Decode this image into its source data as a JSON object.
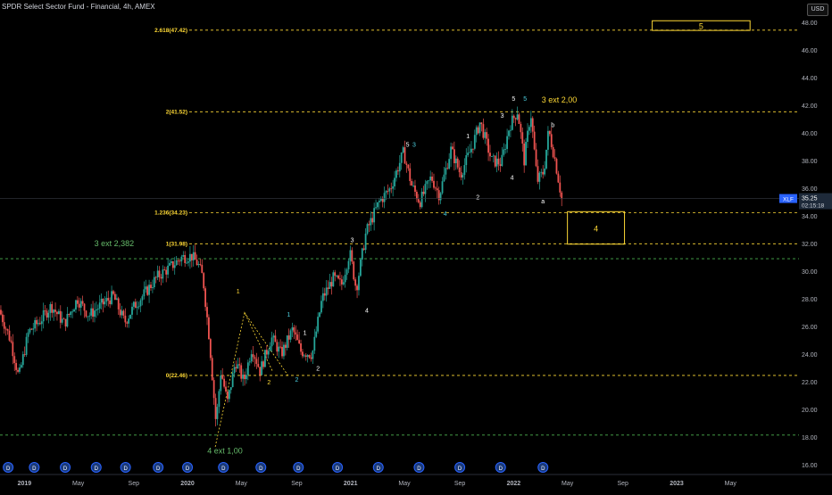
{
  "title": "SPDR Select Sector Fund - Financial, 4h, AMEX",
  "currency_button": "USD",
  "colors": {
    "up": "#26a69a",
    "down": "#ef5350",
    "fib": "#fdd835",
    "green_dash": "#4caf50",
    "axis_text": "#b2b5be",
    "ticker_bg": "#2962ff",
    "wave_white": "#ffffff",
    "wave_cyan": "#4dd0e1",
    "wave_yellow": "#fdd835",
    "wave_green": "#66bb6a"
  },
  "chart_data": {
    "type": "candlestick",
    "symbol": "XLF",
    "last_price_label": "35.25",
    "countdown_label": "02:15:18",
    "last_price_tag_text": "XLF",
    "ylim": [
      15.3,
      49.6
    ],
    "y_ticks": [
      "16.00",
      "18.00",
      "20.00",
      "22.00",
      "24.00",
      "26.00",
      "28.00",
      "30.00",
      "32.00",
      "34.00",
      "36.00",
      "38.00",
      "40.00",
      "42.00",
      "44.00",
      "46.00",
      "48.00"
    ],
    "y_tick_values": [
      16,
      18,
      20,
      22,
      24,
      26,
      28,
      30,
      32,
      34,
      36,
      38,
      40,
      42,
      44,
      46,
      48
    ],
    "x_ticks": [
      "2019",
      "May",
      "Sep",
      "2020",
      "May",
      "Sep",
      "2021",
      "May",
      "Sep",
      "2022",
      "May",
      "Sep",
      "2023",
      "May"
    ],
    "x_tick_dates": [
      2019.0,
      2019.33,
      2019.67,
      2020.0,
      2020.33,
      2020.67,
      2021.0,
      2021.33,
      2021.67,
      2022.0,
      2022.33,
      2022.67,
      2023.0,
      2023.33
    ],
    "xlim": [
      2018.85,
      2023.75
    ],
    "price_path": [
      [
        2018.85,
        27.2
      ],
      [
        2018.92,
        25.0
      ],
      [
        2018.97,
        22.3
      ],
      [
        2019.03,
        25.6
      ],
      [
        2019.1,
        26.4
      ],
      [
        2019.17,
        27.5
      ],
      [
        2019.25,
        26.2
      ],
      [
        2019.33,
        28.0
      ],
      [
        2019.4,
        26.8
      ],
      [
        2019.47,
        27.5
      ],
      [
        2019.55,
        28.2
      ],
      [
        2019.62,
        26.3
      ],
      [
        2019.68,
        27.5
      ],
      [
        2019.75,
        28.5
      ],
      [
        2019.82,
        29.6
      ],
      [
        2019.9,
        30.3
      ],
      [
        2019.97,
        31.0
      ],
      [
        2020.03,
        31.1
      ],
      [
        2020.07,
        30.5
      ],
      [
        2020.1,
        29.5
      ],
      [
        2020.14,
        25.0
      ],
      [
        2020.18,
        19.0
      ],
      [
        2020.21,
        22.8
      ],
      [
        2020.25,
        20.5
      ],
      [
        2020.3,
        23.5
      ],
      [
        2020.35,
        22.0
      ],
      [
        2020.4,
        24.5
      ],
      [
        2020.45,
        22.8
      ],
      [
        2020.52,
        25.2
      ],
      [
        2020.58,
        24.0
      ],
      [
        2020.65,
        25.8
      ],
      [
        2020.7,
        24.2
      ],
      [
        2020.77,
        24.0
      ],
      [
        2020.83,
        28.0
      ],
      [
        2020.9,
        29.5
      ],
      [
        2020.95,
        29.0
      ],
      [
        2021.0,
        31.4
      ],
      [
        2021.04,
        28.7
      ],
      [
        2021.1,
        32.8
      ],
      [
        2021.18,
        35.0
      ],
      [
        2021.25,
        36.0
      ],
      [
        2021.33,
        38.6
      ],
      [
        2021.38,
        36.2
      ],
      [
        2021.43,
        35.0
      ],
      [
        2021.5,
        36.8
      ],
      [
        2021.55,
        35.5
      ],
      [
        2021.62,
        38.8
      ],
      [
        2021.68,
        37.0
      ],
      [
        2021.75,
        39.0
      ],
      [
        2021.8,
        40.8
      ],
      [
        2021.87,
        38.0
      ],
      [
        2021.93,
        37.8
      ],
      [
        2021.98,
        40.5
      ],
      [
        2022.03,
        41.6
      ],
      [
        2022.07,
        38.0
      ],
      [
        2022.11,
        41.5
      ],
      [
        2022.15,
        36.5
      ],
      [
        2022.19,
        37.2
      ],
      [
        2022.22,
        40.2
      ],
      [
        2022.26,
        38.0
      ],
      [
        2022.3,
        35.25
      ]
    ],
    "horizontal_levels": [
      {
        "label": "2.618(47.42)",
        "value": 47.42,
        "style": "fib"
      },
      {
        "label": "2(41.52)",
        "value": 41.52,
        "style": "fib"
      },
      {
        "label": "1.236(34.23)",
        "value": 34.23,
        "style": "fib"
      },
      {
        "label": "1(31.98)",
        "value": 31.98,
        "style": "fib"
      },
      {
        "label": "0(22.46)",
        "value": 22.46,
        "style": "fib"
      },
      {
        "label": "",
        "value": 30.9,
        "style": "green"
      },
      {
        "label": "",
        "value": 18.15,
        "style": "green"
      }
    ],
    "target_boxes": [
      {
        "label": "4",
        "x0": 2022.33,
        "x1": 2022.68,
        "y0": 31.95,
        "y1": 34.3
      },
      {
        "label": "5",
        "x0": 2022.85,
        "x1": 2023.45,
        "y0": 47.4,
        "y1": 48.1
      }
    ],
    "wave_labels": [
      {
        "text": "3 ext 2,382",
        "x": 2019.55,
        "y": 31.8,
        "color": "wave_green",
        "size": 9
      },
      {
        "text": "4 ext 1,00",
        "x": 2020.23,
        "y": 16.8,
        "color": "wave_green",
        "size": 9
      },
      {
        "text": "3 ext 2,00",
        "x": 2022.28,
        "y": 42.2,
        "color": "wave_yellow",
        "size": 9
      },
      {
        "text": "1",
        "x": 2020.31,
        "y": 28.4,
        "color": "wave_yellow",
        "size": 7
      },
      {
        "text": "2",
        "x": 2020.5,
        "y": 21.8,
        "color": "wave_yellow",
        "size": 7
      },
      {
        "text": "1",
        "x": 2020.62,
        "y": 26.7,
        "color": "wave_cyan",
        "size": 7
      },
      {
        "text": "2",
        "x": 2020.67,
        "y": 22.0,
        "color": "wave_cyan",
        "size": 7
      },
      {
        "text": "1",
        "x": 2020.72,
        "y": 25.4,
        "color": "wave_white",
        "size": 7
      },
      {
        "text": "2",
        "x": 2020.8,
        "y": 22.8,
        "color": "wave_white",
        "size": 7
      },
      {
        "text": "3",
        "x": 2021.01,
        "y": 32.1,
        "color": "wave_white",
        "size": 7
      },
      {
        "text": "4",
        "x": 2021.1,
        "y": 27.0,
        "color": "wave_white",
        "size": 7
      },
      {
        "text": "4",
        "x": 2021.58,
        "y": 34.0,
        "color": "wave_cyan",
        "size": 7
      },
      {
        "text": "5",
        "x": 2021.35,
        "y": 39.0,
        "color": "wave_white",
        "size": 7
      },
      {
        "text": "3",
        "x": 2021.39,
        "y": 39.0,
        "color": "wave_cyan",
        "size": 7
      },
      {
        "text": "1",
        "x": 2021.72,
        "y": 39.6,
        "color": "wave_white",
        "size": 7
      },
      {
        "text": "2",
        "x": 2021.78,
        "y": 35.2,
        "color": "wave_white",
        "size": 7
      },
      {
        "text": "3",
        "x": 2021.93,
        "y": 41.1,
        "color": "wave_white",
        "size": 7
      },
      {
        "text": "4",
        "x": 2021.99,
        "y": 36.6,
        "color": "wave_white",
        "size": 7
      },
      {
        "text": "5",
        "x": 2022.0,
        "y": 42.3,
        "color": "wave_white",
        "size": 7
      },
      {
        "text": "5",
        "x": 2022.07,
        "y": 42.3,
        "color": "wave_cyan",
        "size": 7
      },
      {
        "text": "b",
        "x": 2022.24,
        "y": 40.4,
        "color": "wave_white",
        "size": 7
      },
      {
        "text": "a",
        "x": 2022.18,
        "y": 34.9,
        "color": "wave_white",
        "size": 7
      }
    ],
    "dividend_markers_x": [
      2018.9,
      2019.06,
      2019.25,
      2019.44,
      2019.62,
      2019.82,
      2020.0,
      2020.22,
      2020.45,
      2020.68,
      2020.92,
      2021.17,
      2021.42,
      2021.67,
      2021.92,
      2022.18
    ],
    "dividend_marker_label": "D",
    "triangle_lines": [
      [
        [
          2020.17,
          17.3
        ],
        [
          2020.35,
          27.0
        ],
        [
          2020.52,
          22.8
        ]
      ],
      [
        [
          2020.35,
          27.0
        ],
        [
          2020.62,
          22.4
        ]
      ]
    ]
  }
}
